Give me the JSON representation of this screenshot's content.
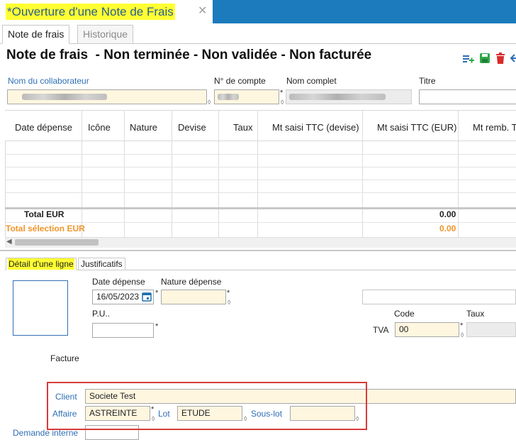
{
  "window_tab": {
    "title": "*Ouverture d'une Note de Frais",
    "close": "✕"
  },
  "subtabs": [
    {
      "label": "Note de frais"
    },
    {
      "label": "Historique"
    }
  ],
  "page_title": "Note de frais  - Non terminée - Non validée - Non facturée",
  "toolbar": {
    "add_icon": "add-line-icon",
    "save_icon": "save-icon",
    "delete_icon": "delete-icon",
    "more_icon": "arrow-icon"
  },
  "header": {
    "collaborateur_label": "Nom du collaborateur",
    "compte_label": "N° de compte",
    "nom_complet_label": "Nom complet",
    "titre_label": "Titre",
    "titre_value": ""
  },
  "grid": {
    "columns": [
      "Date dépense",
      "Icône",
      "Nature",
      "Devise",
      "Taux",
      "Mt saisi TTC (devise)",
      "Mt saisi TTC (EUR)",
      "Mt remb. T"
    ],
    "total_eur_label": "Total EUR",
    "total_eur_value": "0.00",
    "total_sel_label": "Total sélection EUR",
    "total_sel_value": "0.00"
  },
  "detail_tabs": [
    {
      "label": "Détail d'une ligne"
    },
    {
      "label": "Justificatifs"
    }
  ],
  "detail": {
    "date_label": "Date dépense",
    "date_value": "16/05/2023",
    "nature_label": "Nature dépense",
    "nature_value": "",
    "pu_label": "P.U..",
    "pu_value": "",
    "code_label": "Code",
    "taux_label": "Taux",
    "tva_label": "TVA",
    "tva_code_value": "00",
    "facture_label": "Facture",
    "client_label": "Client",
    "client_value": "Societe Test",
    "affaire_label": "Affaire",
    "affaire_value": "ASTREINTE",
    "lot_label": "Lot",
    "lot_value": "ETUDE",
    "souslot_label": "Sous-lot",
    "souslot_value": "",
    "demande_label": "Demande interne"
  },
  "colors": {
    "accent_blue": "#1b7bbd",
    "highlight_yellow": "#ffff33",
    "total_orange": "#f0962a",
    "annotation_red": "#d83a3a"
  }
}
